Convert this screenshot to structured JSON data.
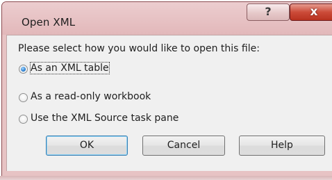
{
  "dialog": {
    "title": "Open XML",
    "help_glyph": "?",
    "close_glyph": "x",
    "prompt": "Please select how you would like to open this file:"
  },
  "options": [
    {
      "label": "As an XML table",
      "checked": true
    },
    {
      "label": "As a read-only workbook",
      "checked": false
    },
    {
      "label": "Use the XML Source task pane",
      "checked": false
    }
  ],
  "buttons": {
    "ok": "OK",
    "cancel": "Cancel",
    "help": "Help"
  },
  "colors": {
    "frame": "#e2b8ba",
    "close_button": "#cc4b39",
    "client": "#f0f0f0",
    "radio_selected": "#1b73c9"
  }
}
